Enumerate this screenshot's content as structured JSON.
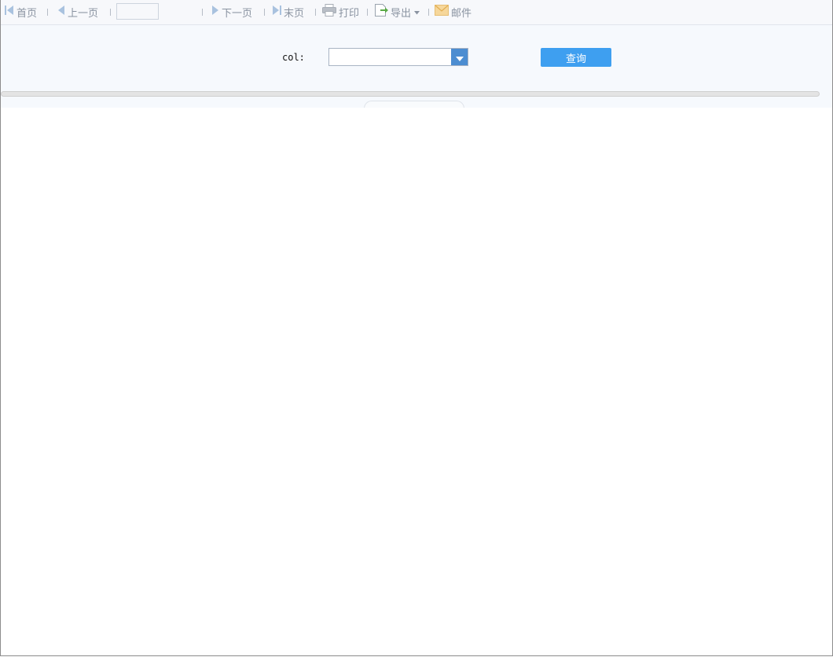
{
  "toolbar": {
    "first_page": {
      "label": "首页",
      "icon": "first-page-icon"
    },
    "prev_page": {
      "label": "上一页",
      "icon": "prev-page-icon"
    },
    "page_number": {
      "value": "",
      "total": ""
    },
    "next_page": {
      "label": "下一页",
      "icon": "next-page-icon"
    },
    "last_page": {
      "label": "末页",
      "icon": "last-page-icon"
    },
    "print": {
      "label": "打印",
      "icon": "printer-icon"
    },
    "export": {
      "label": "导出",
      "icon": "export-icon",
      "dropdown": "caret-down-icon"
    },
    "email": {
      "label": "邮件",
      "icon": "mail-icon"
    }
  },
  "parameters": {
    "col_label": "col:",
    "col_value": "",
    "query_button": "查询"
  },
  "colors": {
    "toolbar_bg": "#f7f8fb",
    "param_bg": "#f6f9fd",
    "nav_icon": "#a9c2df",
    "combo_button": "#4c8dd1",
    "query_button": "#3e9ff0"
  }
}
